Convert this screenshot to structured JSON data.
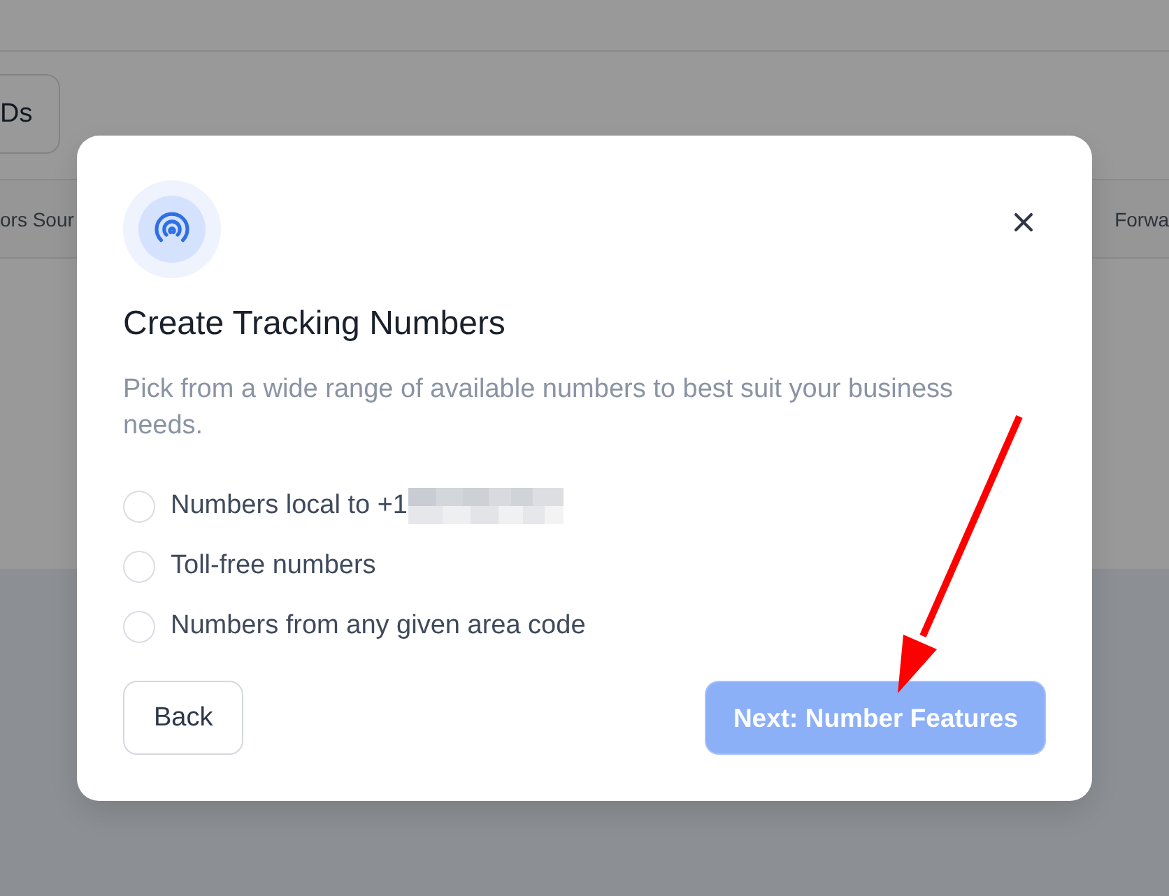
{
  "background_page": {
    "toolbar_button": "Ds",
    "table_columns": [
      "ors Sour",
      "Forwa"
    ]
  },
  "dialog": {
    "title": "Create Tracking Numbers",
    "description": "Pick from a wide range of available numbers to best suit your business needs.",
    "options": [
      {
        "label": "Numbers local to +1",
        "redacted": true,
        "selected": false
      },
      {
        "label": "Toll-free numbers",
        "redacted": false,
        "selected": false
      },
      {
        "label": "Numbers from any given area code",
        "redacted": false,
        "selected": false
      }
    ],
    "back_button": "Back",
    "next_button": {
      "label": "Next: Number Features",
      "disabled": true
    }
  }
}
